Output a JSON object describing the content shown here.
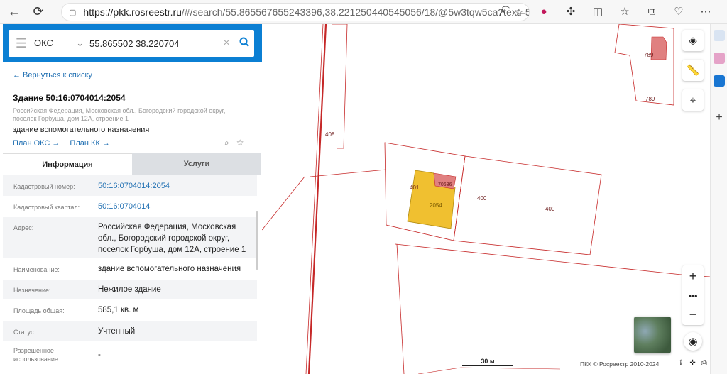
{
  "browser": {
    "url_host": "https://pkk.rosreestr.ru",
    "url_rest": "/#/search/55.865567655243396,38.221250440545056/18/@5w3tqw5ca?text=55.86550...",
    "icons": [
      "back-icon",
      "refresh-icon",
      "lock-icon",
      "read-aloud-icon",
      "favorite-icon",
      "extension-icon",
      "split-icon",
      "collections-icon",
      "copilot-icon"
    ]
  },
  "search": {
    "type_label": "ОКС",
    "query": "55.865502 38.220704"
  },
  "card": {
    "back_label": "← Вернуться к списку",
    "title": "Здание 50:16:0704014:2054",
    "address_small": "Российская Федерация, Московская обл., Богородский городской округ, поселок Горбуша, дом 12А, строение 1",
    "kind": "здание вспомогательного назначения",
    "plan_oks": "План ОКС →",
    "plan_kk": "План КК →"
  },
  "tabs": {
    "info": "Информация",
    "services": "Услуги"
  },
  "props": [
    {
      "label": "Кадастровый номер:",
      "value": "50:16:0704014:2054"
    },
    {
      "label": "Кадастровый квартал:",
      "value": "50:16:0704014"
    },
    {
      "label": "Адрес:",
      "value": "Российская Федерация, Московская обл., Богородский городской округ, поселок Горбуша, дом 12А, строение 1"
    },
    {
      "label": "Наименование:",
      "value": "здание вспомогательного назначения"
    },
    {
      "label": "Назначение:",
      "value": "Нежилое здание"
    },
    {
      "label": "Площадь общая:",
      "value": "585,1 кв. м"
    },
    {
      "label": "Статус:",
      "value": "Учтенный"
    },
    {
      "label": "Разрешенное использование:",
      "value": "-"
    }
  ],
  "map": {
    "parcel_labels": [
      "789",
      "789",
      "408",
      "400",
      "400",
      "401",
      "2054",
      "70636"
    ],
    "scale_label": "30 м",
    "copyright": "ПКК © Росреестр 2010-2024",
    "colors": {
      "parcel_line": "#c62828",
      "building_fill": "#f0c030",
      "building2_fill": "#e08080",
      "accent": "#0b7fd3"
    }
  }
}
